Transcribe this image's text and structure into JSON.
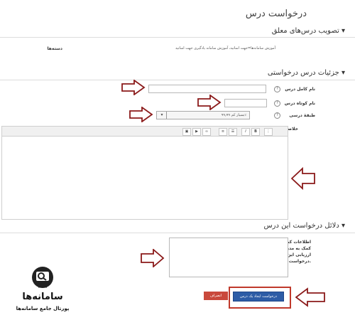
{
  "page": {
    "title": "درخواست درس"
  },
  "sections": {
    "approval": {
      "title": "تصویب درس‌های معلق"
    },
    "details": {
      "title": "جزئیات درس درخواستی"
    },
    "reason": {
      "title": "دلائل درخواست این درس"
    }
  },
  "approval": {
    "categories_label": "دسته‌ها",
    "categories_value": "آموزش سامانه‌ها=جهت اساتید، آموزش سامانه یادگیری جهت اساتید"
  },
  "form": {
    "fullname_label": "نام کامل درس",
    "shortname_label": "نام کوتاه درس",
    "category_label": "طبقهٔ درسی",
    "category_value": "بسیار کم ۹۹٫۹۹٪",
    "summary_label": "خلاصه",
    "help_mark": "?"
  },
  "reason": {
    "label": "اطلاعات کمکی برای کمک به مدیر در ارزیابی این درخواست."
  },
  "toolbar": {
    "items": [
      "image-icon",
      "media-icon",
      "link-icon",
      "unlink-icon",
      "ordered-list-icon",
      "unordered-list-icon",
      "italic-icon",
      "bold-icon",
      "format-icon"
    ]
  },
  "buttons": {
    "submit": "درخواست ایجاد یک درس",
    "cancel": "انصراف"
  },
  "logo": {
    "brand": "سامانه‌ها",
    "subtitle": "پورتال جامع سامانه‌ها"
  },
  "colors": {
    "accent_blue": "#2d5ca6",
    "cancel_red": "#c9493c",
    "arrow_outline": "#8b1a1a",
    "highlight_red": "#c0392b"
  }
}
